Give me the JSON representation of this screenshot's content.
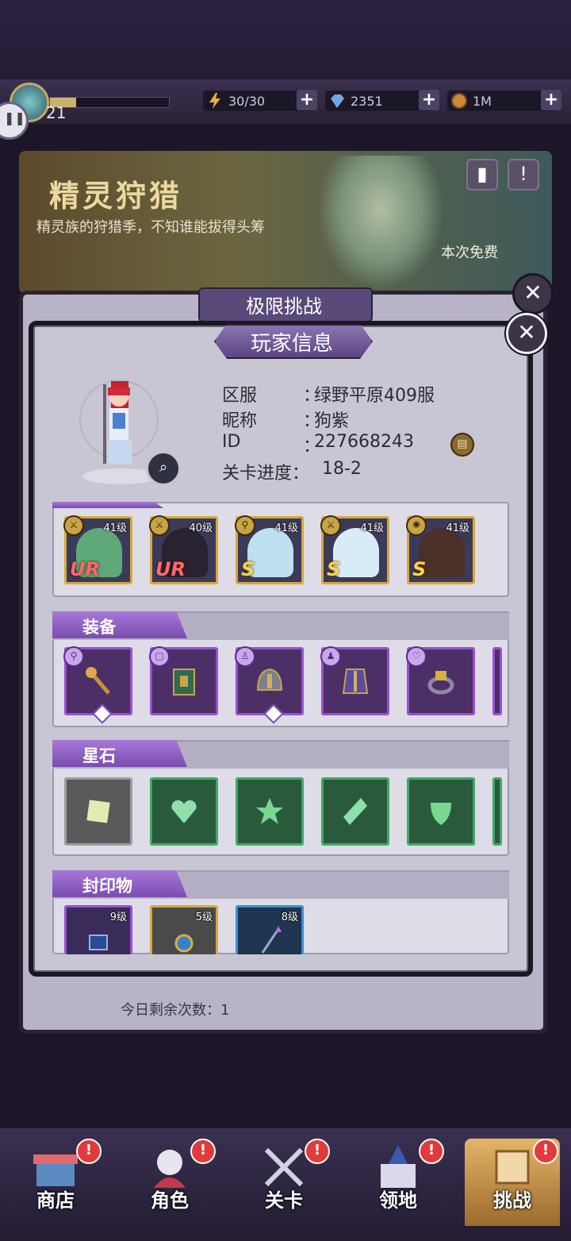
{
  "topbar": {
    "level": "21",
    "exp_progress": 0.22,
    "resources": [
      {
        "name": "stamina",
        "value": "30/30",
        "icon": "lightning-icon"
      },
      {
        "name": "diamond",
        "value": "2351",
        "icon": "diamond-icon"
      },
      {
        "name": "gold",
        "value": "1M",
        "icon": "coin-icon"
      }
    ],
    "plus": "+"
  },
  "banner": {
    "title": "精灵狩猎",
    "subtitle": "精灵族的狩猎季，不知谁能拔得头筹",
    "free_label": "本次免费"
  },
  "behind_panel": {
    "title": "极限挑战",
    "remaining": "今日剩余次数：1"
  },
  "modal": {
    "title": "玩家信息",
    "close": "✕",
    "info": [
      {
        "label": "区服",
        "colon": "：",
        "value": "绿野平原409服"
      },
      {
        "label": "昵称",
        "colon": "：",
        "value": "狗紫"
      },
      {
        "label": "ID",
        "colon": "：",
        "value": "227668243"
      },
      {
        "label": "关卡进度：",
        "colon": "",
        "value": "18-2"
      }
    ],
    "heroes": [
      {
        "level": "41级",
        "rarity": "UR",
        "color": "#5fa87a"
      },
      {
        "level": "40级",
        "rarity": "UR",
        "color": "#2a2230"
      },
      {
        "level": "41级",
        "rarity": "S",
        "color": "#bfe0f0"
      },
      {
        "level": "41级",
        "rarity": "S",
        "color": "#d8ecf8"
      },
      {
        "level": "41级",
        "rarity": "S",
        "color": "#4a3028"
      }
    ],
    "sections": {
      "equipment": "装备",
      "star_stones": "星石",
      "seals": "封印物"
    },
    "equipment_items": [
      "scepter-icon",
      "book-icon",
      "helmet-icon",
      "armor-icon",
      "ring-icon"
    ],
    "gems": [
      {
        "shape": "square-gem-icon",
        "rarity": "grey"
      },
      {
        "shape": "heart-gem-icon",
        "rarity": "green"
      },
      {
        "shape": "star-gem-icon",
        "rarity": "green"
      },
      {
        "shape": "diamond-gem-icon",
        "rarity": "green"
      },
      {
        "shape": "shield-gem-icon",
        "rarity": "green"
      }
    ],
    "seals": [
      {
        "level": "9级",
        "rarity": "purple",
        "icon": "chip-icon"
      },
      {
        "level": "5级",
        "rarity": "gold",
        "icon": "amulet-icon"
      },
      {
        "level": "8级",
        "rarity": "blue",
        "icon": "spear-icon"
      }
    ]
  },
  "nav": [
    {
      "label": "商店",
      "icon": "shop-icon",
      "badge": "!"
    },
    {
      "label": "角色",
      "icon": "character-icon",
      "badge": "!"
    },
    {
      "label": "关卡",
      "icon": "swords-icon",
      "badge": "!"
    },
    {
      "label": "领地",
      "icon": "castle-icon",
      "badge": "!"
    },
    {
      "label": "挑战",
      "icon": "scroll-icon",
      "badge": "!",
      "active": true
    }
  ]
}
